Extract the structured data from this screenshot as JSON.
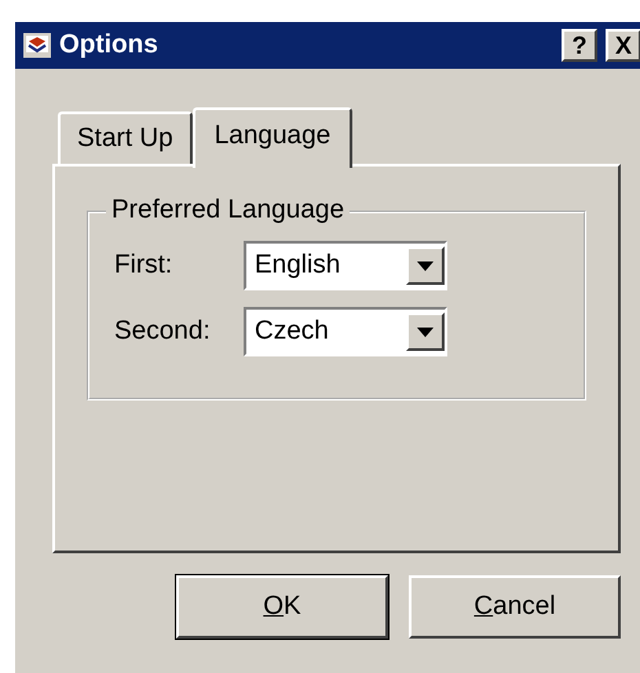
{
  "window": {
    "title": "Options",
    "title_buttons": [
      "?",
      "X"
    ]
  },
  "tabs": [
    {
      "label": "Start Up",
      "selected": false
    },
    {
      "label": "Language",
      "selected": true
    }
  ],
  "group": {
    "title": "Preferred Language",
    "fields": [
      {
        "label": "First:",
        "value": "English"
      },
      {
        "label": "Second:",
        "value": "Czech"
      }
    ]
  },
  "buttons": [
    {
      "mnemonic": "O",
      "rest": "K",
      "default": true
    },
    {
      "mnemonic": "C",
      "rest": "ancel",
      "default": false
    }
  ]
}
